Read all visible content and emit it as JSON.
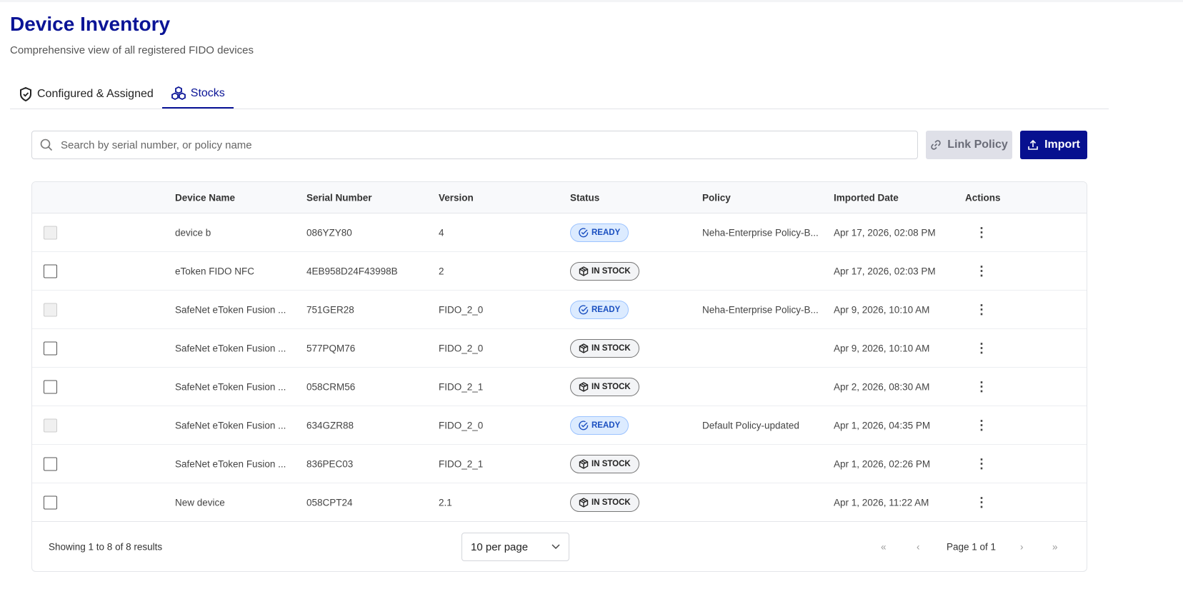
{
  "header": {
    "title": "Device Inventory",
    "subtitle": "Comprehensive view of all registered FIDO devices"
  },
  "tabs": [
    {
      "label": "Configured & Assigned",
      "icon": "shield-check-icon"
    },
    {
      "label": "Stocks",
      "icon": "cubes-icon",
      "active": true
    }
  ],
  "search": {
    "placeholder": "Search by serial number, or policy name",
    "value": ""
  },
  "toolbar": {
    "link_policy": "Link Policy",
    "import": "Import"
  },
  "colors": {
    "brand": "#0a1496",
    "ready_bg": "#dcebff",
    "ready_text": "#1a4fc0"
  },
  "table": {
    "columns": [
      "Device Name",
      "Serial Number",
      "Version",
      "Status",
      "Policy",
      "Imported Date",
      "Actions"
    ],
    "rows": [
      {
        "name": "device b",
        "serial": "086YZY80",
        "version": "4",
        "status": "READY",
        "policy": "Neha-Enterprise Policy-B...",
        "date": "Apr 17, 2026, 02:08 PM",
        "disabled": true
      },
      {
        "name": "eToken FIDO NFC",
        "serial": "4EB958D24F43998B",
        "version": "2",
        "status": "IN STOCK",
        "policy": "",
        "date": "Apr 17, 2026, 02:03 PM",
        "disabled": false
      },
      {
        "name": "SafeNet eToken Fusion ...",
        "serial": "751GER28",
        "version": "FIDO_2_0",
        "status": "READY",
        "policy": "Neha-Enterprise Policy-B...",
        "date": "Apr 9, 2026, 10:10 AM",
        "disabled": true
      },
      {
        "name": "SafeNet eToken Fusion ...",
        "serial": "577PQM76",
        "version": "FIDO_2_0",
        "status": "IN STOCK",
        "policy": "",
        "date": "Apr 9, 2026, 10:10 AM",
        "disabled": false
      },
      {
        "name": "SafeNet eToken Fusion ...",
        "serial": "058CRM56",
        "version": "FIDO_2_1",
        "status": "IN STOCK",
        "policy": "",
        "date": "Apr 2, 2026, 08:30 AM",
        "disabled": false
      },
      {
        "name": "SafeNet eToken Fusion ...",
        "serial": "634GZR88",
        "version": "FIDO_2_0",
        "status": "READY",
        "policy": "Default Policy-updated",
        "date": "Apr 1, 2026, 04:35 PM",
        "disabled": true
      },
      {
        "name": "SafeNet eToken Fusion ...",
        "serial": "836PEC03",
        "version": "FIDO_2_1",
        "status": "IN STOCK",
        "policy": "",
        "date": "Apr 1, 2026, 02:26 PM",
        "disabled": false
      },
      {
        "name": "New device",
        "serial": "058CPT24",
        "version": "2.1",
        "status": "IN STOCK",
        "policy": "",
        "date": "Apr 1, 2026, 11:22 AM",
        "disabled": false
      }
    ]
  },
  "footer": {
    "summary": "Showing 1 to 8 of 8 results",
    "per_page": "10 per page",
    "page": "Page 1 of 1"
  }
}
